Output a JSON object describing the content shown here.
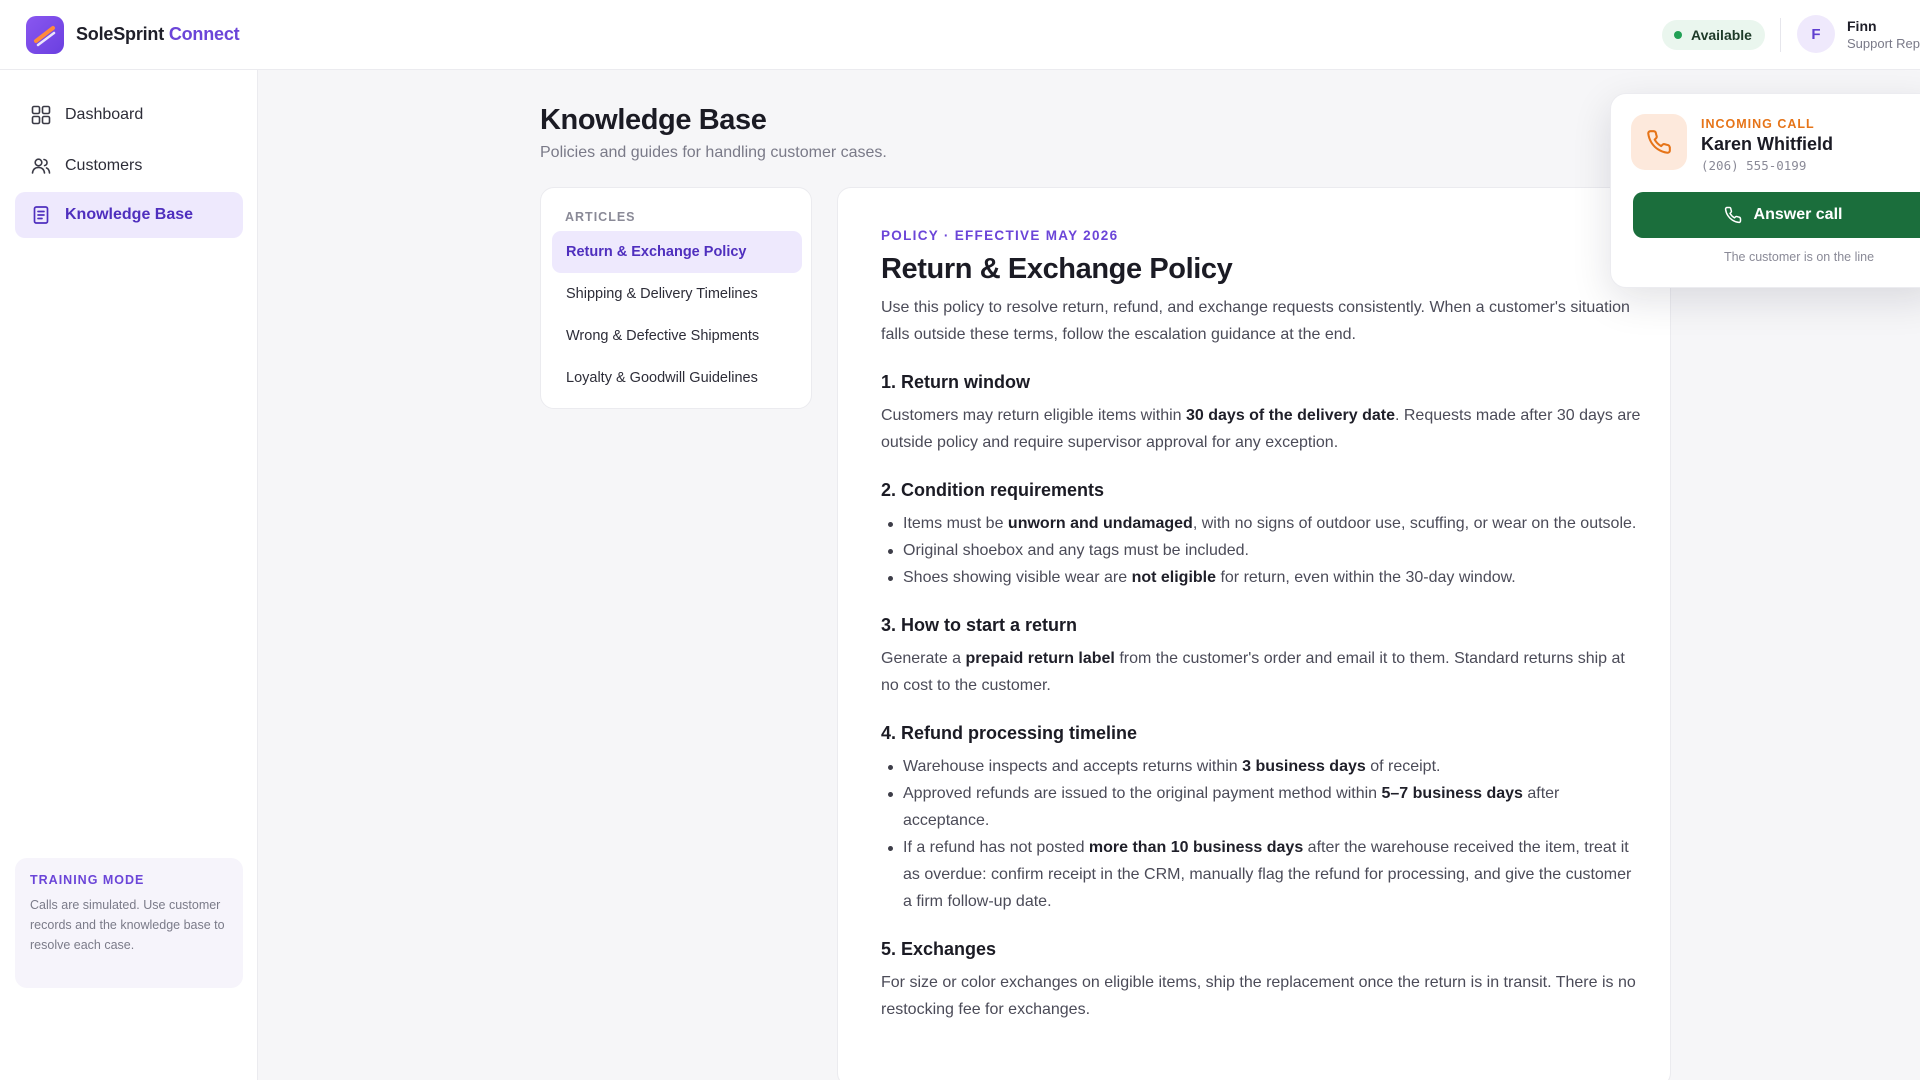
{
  "brand": {
    "name": "SoleSprint",
    "product": "Connect"
  },
  "status": {
    "label": "Available",
    "color": "#21a055"
  },
  "user": {
    "initial": "F",
    "name": "Finn",
    "role": "Support Rep"
  },
  "sidebar": {
    "items": [
      {
        "label": "Dashboard",
        "icon": "grid-icon",
        "active": false
      },
      {
        "label": "Customers",
        "icon": "users-icon",
        "active": false
      },
      {
        "label": "Knowledge Base",
        "icon": "book-icon",
        "active": true
      }
    ],
    "training": {
      "title": "TRAINING MODE",
      "text": "Calls are simulated. Use customer records and the knowledge base to resolve each case."
    }
  },
  "page": {
    "title": "Knowledge Base",
    "subtitle": "Policies and guides for handling customer cases."
  },
  "articles": {
    "label": "ARTICLES",
    "items": [
      "Return & Exchange Policy",
      "Shipping & Delivery Timelines",
      "Wrong & Defective Shipments",
      "Loyalty & Goodwill Guidelines"
    ],
    "active_index": 0
  },
  "doc": {
    "eyebrow": "POLICY · EFFECTIVE MAY 2026",
    "title": "Return & Exchange Policy",
    "intro": "Use this policy to resolve return, refund, and exchange requests consistently. When a customer's situation falls outside these terms, follow the escalation guidance at the end.",
    "s1": {
      "title": "1. Return window",
      "p_a": "Customers may return eligible items within ",
      "p_b": "30 days of the delivery date",
      "p_c": ". Requests made after 30 days are outside policy and require supervisor approval for any exception."
    },
    "s2": {
      "title": "2. Condition requirements",
      "li1_a": "Items must be ",
      "li1_b": "unworn and undamaged",
      "li1_c": ", with no signs of outdoor use, scuffing, or wear on the outsole.",
      "li2": "Original shoebox and any tags must be included.",
      "li3_a": "Shoes showing visible wear are ",
      "li3_b": "not eligible",
      "li3_c": " for return, even within the 30-day window."
    },
    "s3": {
      "title": "3. How to start a return",
      "p_a": "Generate a ",
      "p_b": "prepaid return label",
      "p_c": " from the customer's order and email it to them. Standard returns ship at no cost to the customer."
    },
    "s4": {
      "title": "4. Refund processing timeline",
      "li1_a": "Warehouse inspects and accepts returns within ",
      "li1_b": "3 business days",
      "li1_c": " of receipt.",
      "li2_a": "Approved refunds are issued to the original payment method within ",
      "li2_b": "5–7 business days",
      "li2_c": " after acceptance.",
      "li3_a": "If a refund has not posted ",
      "li3_b": "more than 10 business days",
      "li3_c": " after the warehouse received the item, treat it as overdue: confirm receipt in the CRM, manually flag the refund for processing, and give the customer a firm follow-up date."
    },
    "s5": {
      "title": "5. Exchanges",
      "p": "For size or color exchanges on eligible items, ship the replacement once the return is in transit. There is no restocking fee for exchanges."
    }
  },
  "call": {
    "eyebrow": "INCOMING CALL",
    "name": "Karen Whitfield",
    "phone": "(206) 555-0199",
    "button": "Answer call",
    "footer": "The customer is on the line",
    "accent": "#e67418",
    "button_color": "#1b6e3c"
  }
}
